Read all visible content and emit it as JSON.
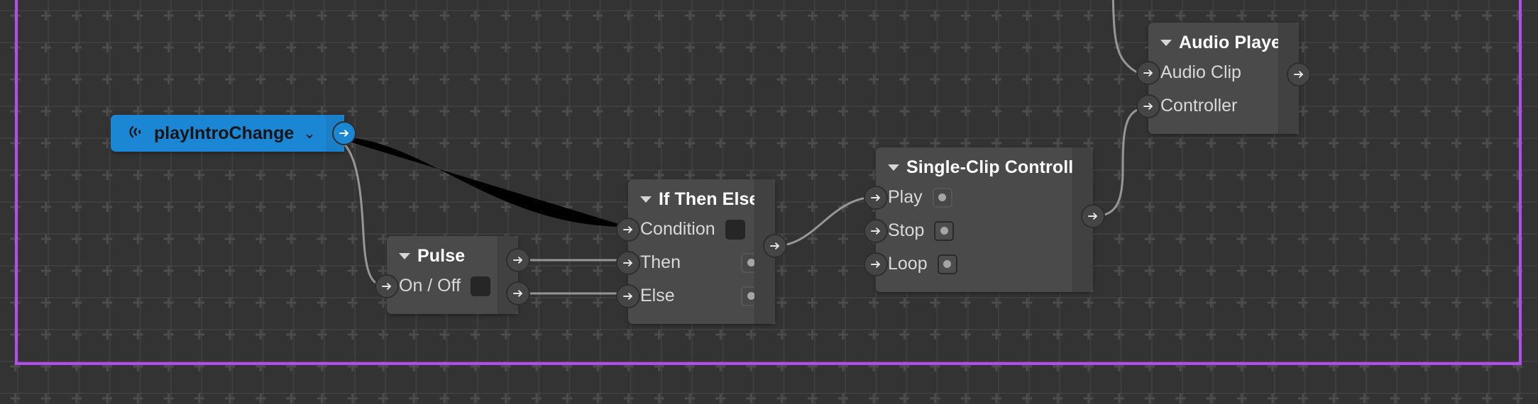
{
  "editor": {
    "name": "node-graph-editor",
    "background_color": "#333333",
    "grid_color": "#484848",
    "selection_frame_color": "#b44df0",
    "wire_color": "#a8a8a8"
  },
  "event_node": {
    "label": "playIntroChange",
    "icon": "broadcast-icon",
    "chevron": "⌄",
    "accent_color": "#1b87d4",
    "output_port_label": "output"
  },
  "nodes": [
    {
      "id": "pulse",
      "title": "Pulse",
      "collapse_icon": "triangle-down-icon",
      "inputs": [
        {
          "label": "On / Off",
          "widget": "dark-square"
        }
      ],
      "outputs": [
        "out-a",
        "out-b"
      ]
    },
    {
      "id": "if-then-else",
      "title": "If Then Else",
      "collapse_icon": "triangle-down-icon",
      "inputs": [
        {
          "label": "Condition",
          "widget": "dark-square"
        },
        {
          "label": "Then",
          "widget": "radio-dot"
        },
        {
          "label": "Else",
          "widget": "radio-dot"
        }
      ],
      "outputs": [
        "out"
      ]
    },
    {
      "id": "single-clip-controller",
      "title": "Single-Clip Controller",
      "collapse_icon": "triangle-down-icon",
      "inputs": [
        {
          "label": "Play",
          "widget": "radio-dot-light"
        },
        {
          "label": "Stop",
          "widget": "radio-dot"
        },
        {
          "label": "Loop",
          "widget": "radio-dot"
        }
      ],
      "outputs": [
        "out"
      ]
    },
    {
      "id": "audio-player",
      "title": "Audio Player",
      "collapse_icon": "triangle-down-icon",
      "inputs": [
        {
          "label": "Audio Clip",
          "widget": "none"
        },
        {
          "label": "Controller",
          "widget": "none"
        }
      ],
      "outputs": [
        "out"
      ]
    }
  ]
}
